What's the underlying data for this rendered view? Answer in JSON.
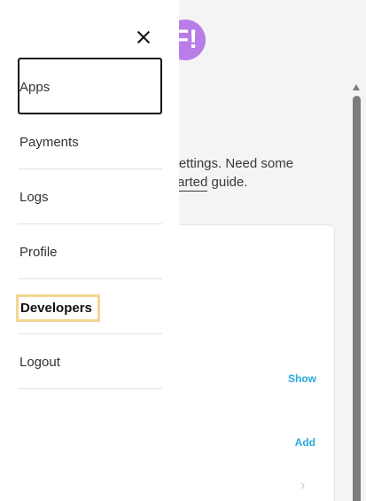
{
  "background": {
    "avatar_letter": "F!",
    "intro_text_before": "I settings. Need some",
    "intro_link": "Started",
    "intro_text_after": "guide.",
    "show_label": "Show",
    "add_label": "Add",
    "chevron_glyph": "›"
  },
  "drawer": {
    "close_glyph": "×",
    "items": [
      {
        "label": "Apps"
      },
      {
        "label": "Payments"
      },
      {
        "label": "Logs"
      },
      {
        "label": "Profile"
      },
      {
        "label": "Developers"
      },
      {
        "label": "Logout"
      }
    ]
  },
  "colors": {
    "avatar": "#b97de8",
    "link_blue": "#2aa9de",
    "highlight_outline": "#f5d592",
    "active_outline": "#111111"
  }
}
